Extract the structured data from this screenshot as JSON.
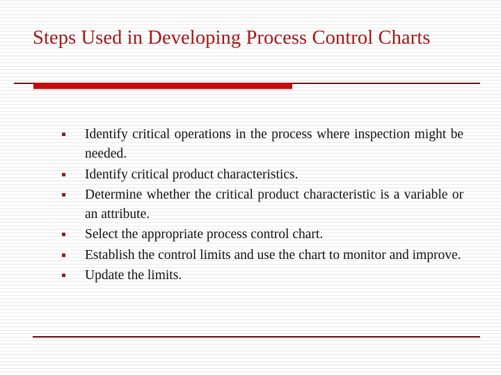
{
  "slide": {
    "title": "Steps Used in Developing Process Control Charts",
    "title_color": "#a81616",
    "background_color": "#ffffff",
    "body_text_color": "#111111",
    "accent_bar_color": "#cc0b0b",
    "rule_color": "#7d1114",
    "bullet_marker_color": "#9c1b1b",
    "bullet_glyph": "square-bullet-icon",
    "bullets": [
      {
        "text": "Identify critical operations in the process where inspection might be needed."
      },
      {
        "text": "Identify critical product characteristics."
      },
      {
        "text": "Determine whether the critical product characteristic is a variable or an attribute."
      },
      {
        "text": "Select the appropriate process control chart."
      },
      {
        "text": "Establish the control limits and use the chart to monitor and improve."
      },
      {
        "text": "Update the limits."
      }
    ]
  }
}
